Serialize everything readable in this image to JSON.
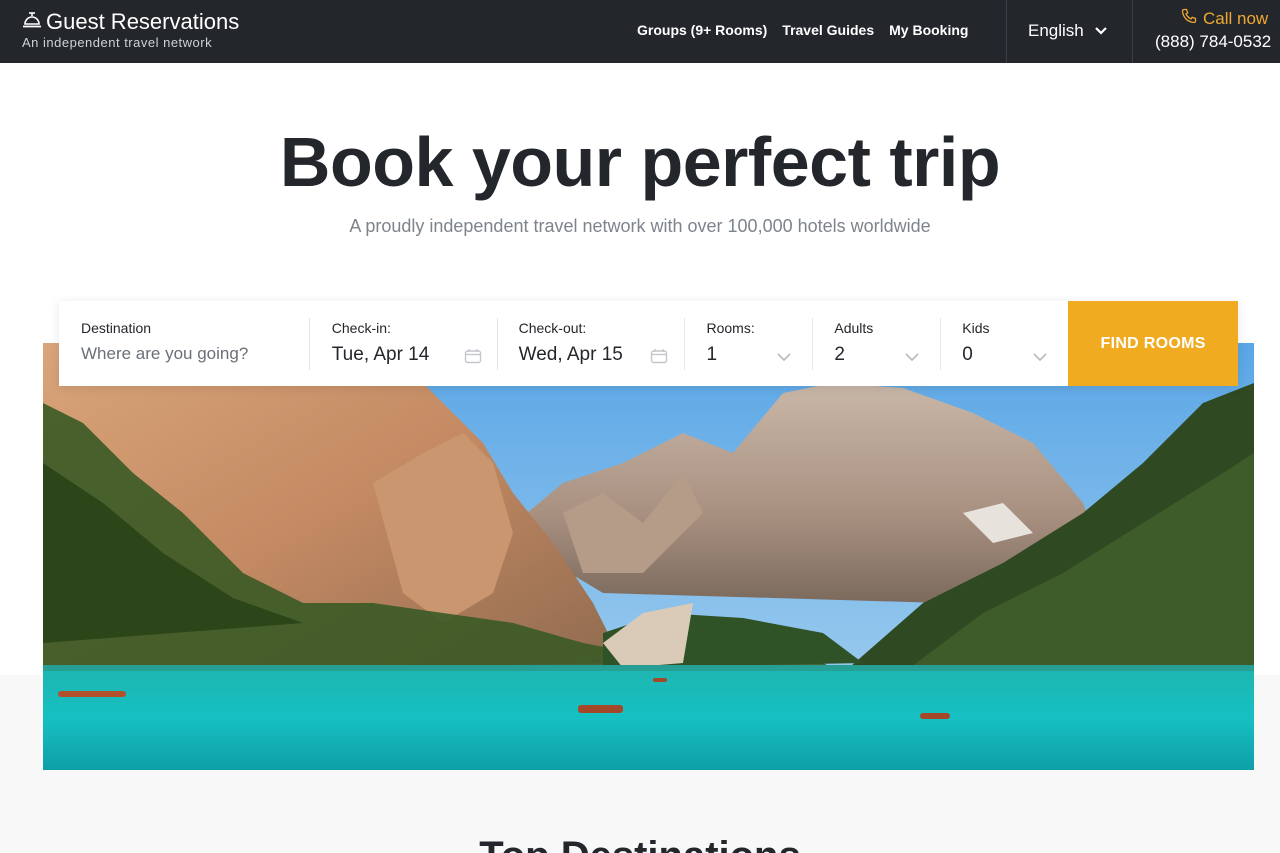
{
  "header": {
    "brand": "Guest Reservations",
    "tagline": "An independent travel network",
    "nav": [
      "Groups (9+ Rooms)",
      "Travel Guides",
      "My Booking"
    ],
    "language": "English",
    "call_label": "Call now",
    "phone": "(888) 784-0532"
  },
  "hero": {
    "title": "Book your perfect trip",
    "subtitle": "A proudly independent travel network with over 100,000 hotels worldwide"
  },
  "search": {
    "destination_label": "Destination",
    "destination_placeholder": "Where are you going?",
    "checkin_label": "Check-in:",
    "checkin_value": "Tue, Apr 14",
    "checkout_label": "Check-out:",
    "checkout_value": "Wed, Apr 15",
    "rooms_label": "Rooms:",
    "rooms_value": "1",
    "adults_label": "Adults",
    "adults_value": "2",
    "kids_label": "Kids",
    "kids_value": "0",
    "button": "FIND ROOMS"
  },
  "sections": {
    "top_destinations": "Top Destinations"
  },
  "colors": {
    "header_bg": "#23262b",
    "accent": "#f0ab21",
    "call_accent": "#f0a832"
  }
}
